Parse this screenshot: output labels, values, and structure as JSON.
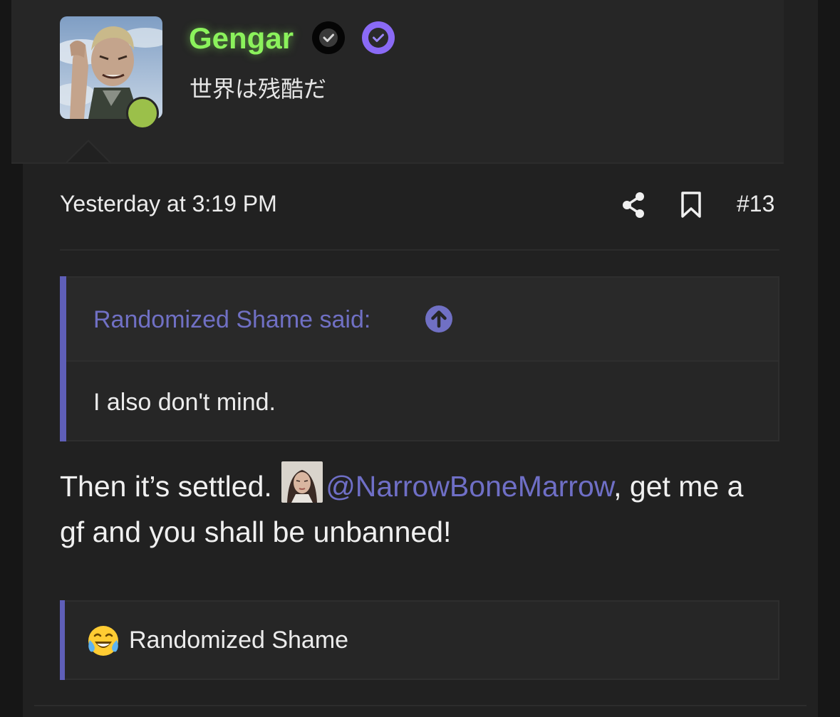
{
  "user": {
    "name": "Gengar",
    "title": "世界は残酷だ",
    "avatar_icon": "user-avatar-anime-character",
    "online": true,
    "name_color": "#8bf25c"
  },
  "badges": [
    {
      "icon": "check-circle-icon",
      "color": "#050505"
    },
    {
      "icon": "verified-check-icon",
      "color": "#8a6af5"
    }
  ],
  "post": {
    "timestamp": "Yesterday at 3:19 PM",
    "number": "#13",
    "share_icon": "share-icon",
    "bookmark_icon": "bookmark-icon"
  },
  "quote": {
    "author_line": "Randomized Shame said:",
    "text": "I also don't mind.",
    "accent_color": "#5f5fb8"
  },
  "message": {
    "text_before": "Then it’s settled. ",
    "mention": "@NarrowBoneMarrow",
    "text_after": ", get me a gf and you shall be unbanned!",
    "mention_color": "#6f6fc6"
  },
  "reactions": {
    "emoji_icon": "laughing-crying-emoji-icon",
    "users": "Randomized Shame"
  },
  "colors": {
    "background": "#161616",
    "card": "#212121",
    "header": "#262626"
  }
}
